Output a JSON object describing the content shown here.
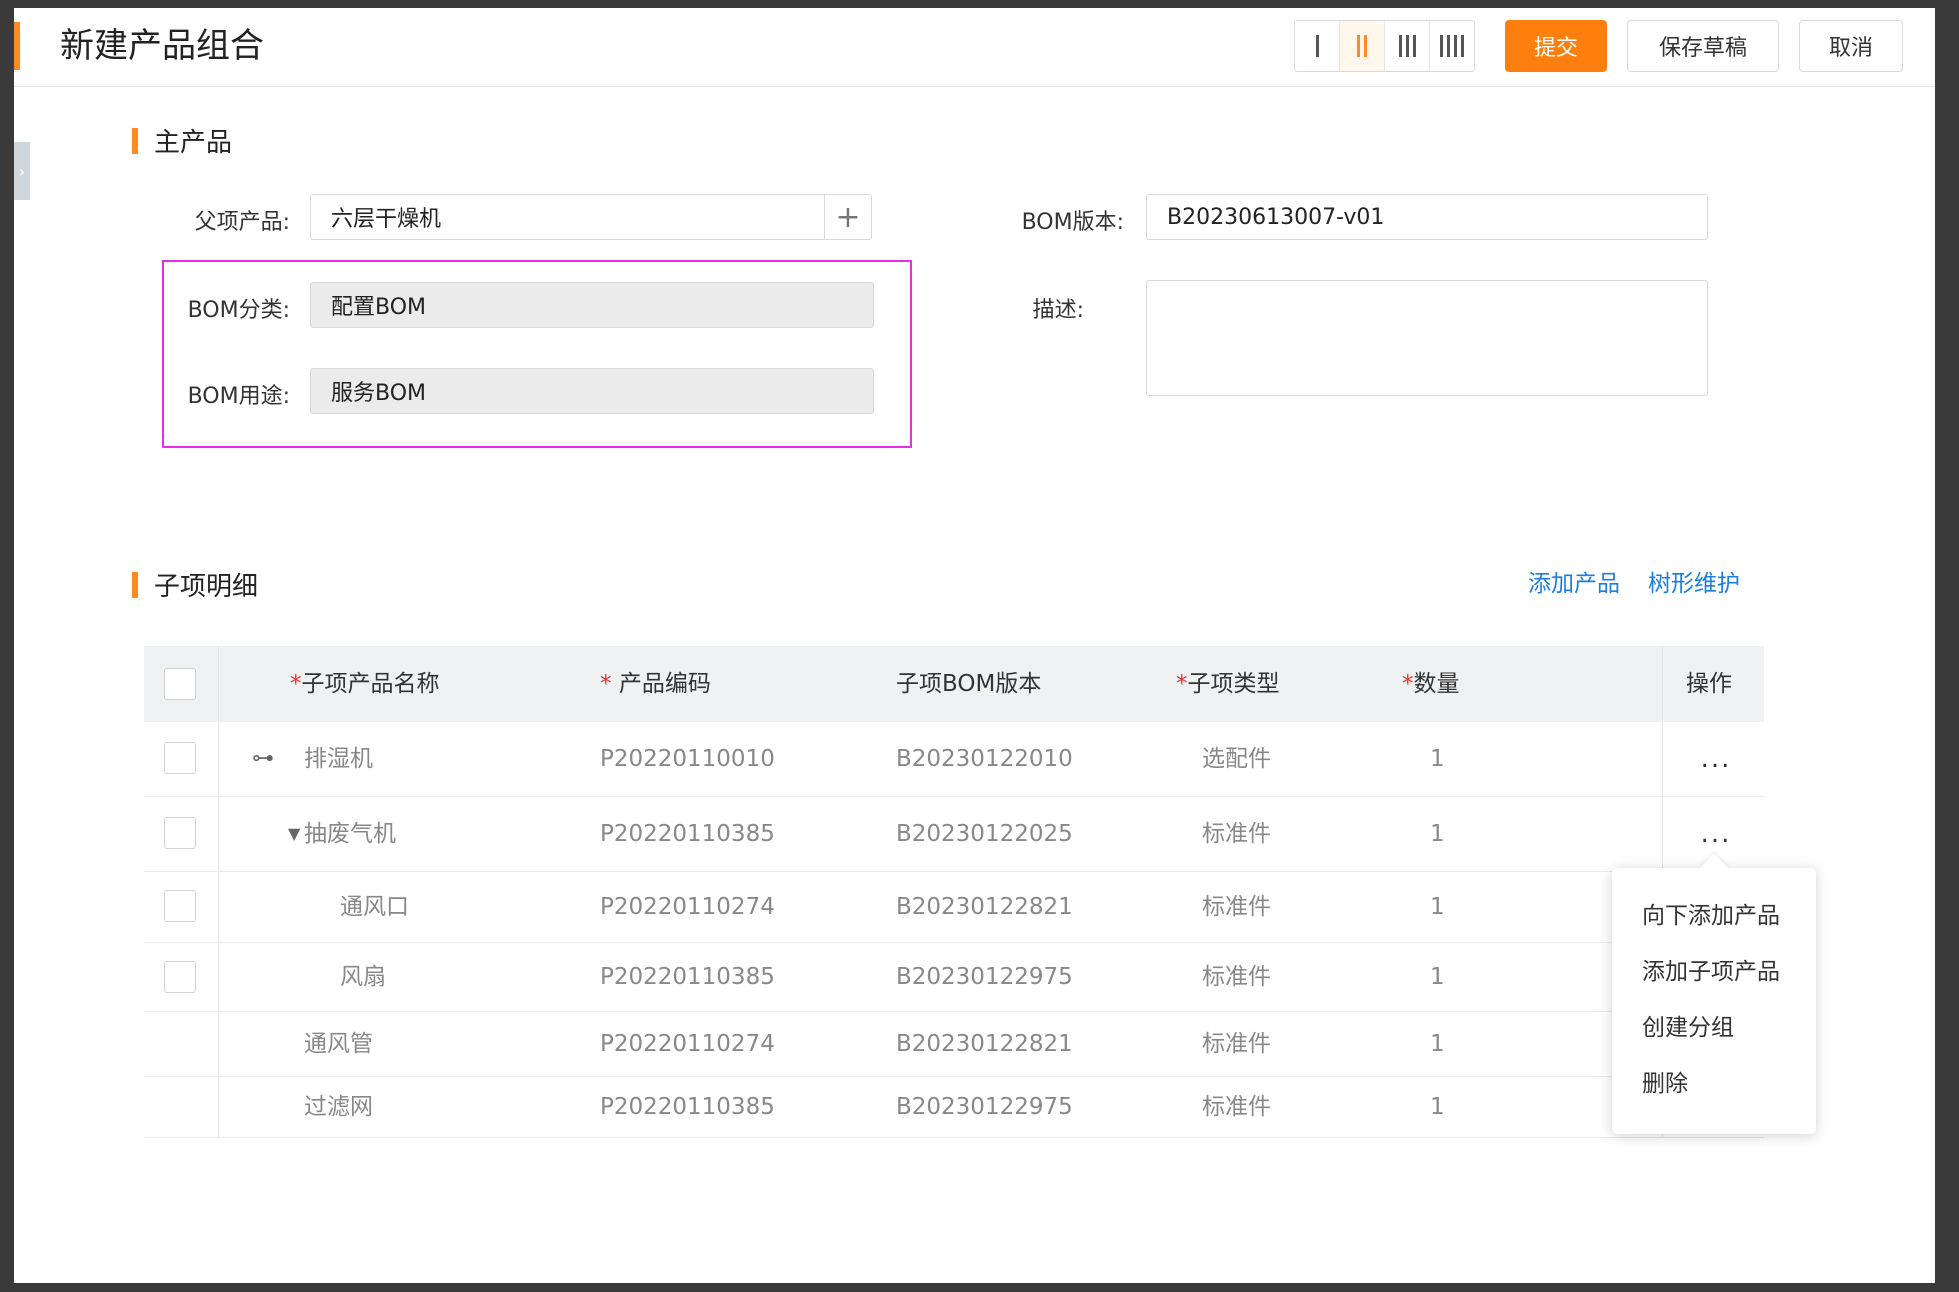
{
  "header": {
    "title": "新建产品组合",
    "column_switch": [
      "I",
      "II",
      "III",
      "IIII"
    ],
    "active_column": "II",
    "submit_label": "提交",
    "save_draft_label": "保存草稿",
    "cancel_label": "取消"
  },
  "main_product": {
    "section_title": "主产品",
    "parent_product_label": "父项产品:",
    "parent_product_value": "六层干燥机",
    "bom_version_label": "BOM版本:",
    "bom_version_value": "B20230613007-v01",
    "bom_category_label": "BOM分类:",
    "bom_category_value": "配置BOM",
    "bom_usage_label": "BOM用途:",
    "bom_usage_value": "服务BOM",
    "description_label": "描述:",
    "description_value": ""
  },
  "children": {
    "section_title": "子项明细",
    "add_product_link": "添加产品",
    "tree_maintain_link": "树形维护",
    "columns": {
      "name": "子项产品名称",
      "code": "产品编码",
      "bom_version": "子项BOM版本",
      "type": "子项类型",
      "quantity": "数量",
      "action": "操作"
    },
    "rows": [
      {
        "name": "排湿机",
        "code": "P20220110010",
        "bom": "B20230122010",
        "type": "选配件",
        "qty": "1"
      },
      {
        "name": "抽废气机",
        "code": "P20220110385",
        "bom": "B20230122025",
        "type": "标准件",
        "qty": "1"
      },
      {
        "name": "通风口",
        "code": "P20220110274",
        "bom": "B20230122821",
        "type": "标准件",
        "qty": "1"
      },
      {
        "name": "风扇",
        "code": "P20220110385",
        "bom": "B20230122975",
        "type": "标准件",
        "qty": "1"
      },
      {
        "name": "通风管",
        "code": "P20220110274",
        "bom": "B20230122821",
        "type": "标准件",
        "qty": "1"
      },
      {
        "name": "过滤网",
        "code": "P20220110385",
        "bom": "B20230122975",
        "type": "标准件",
        "qty": "1"
      }
    ],
    "more_label": "...",
    "context_menu": [
      "向下添加产品",
      "添加子项产品",
      "创建分组",
      "删除"
    ]
  },
  "colors": {
    "accent": "#ff7f0e",
    "link": "#1a7fe0",
    "required": "#e8332b",
    "highlight_border": "#e62ee6"
  }
}
